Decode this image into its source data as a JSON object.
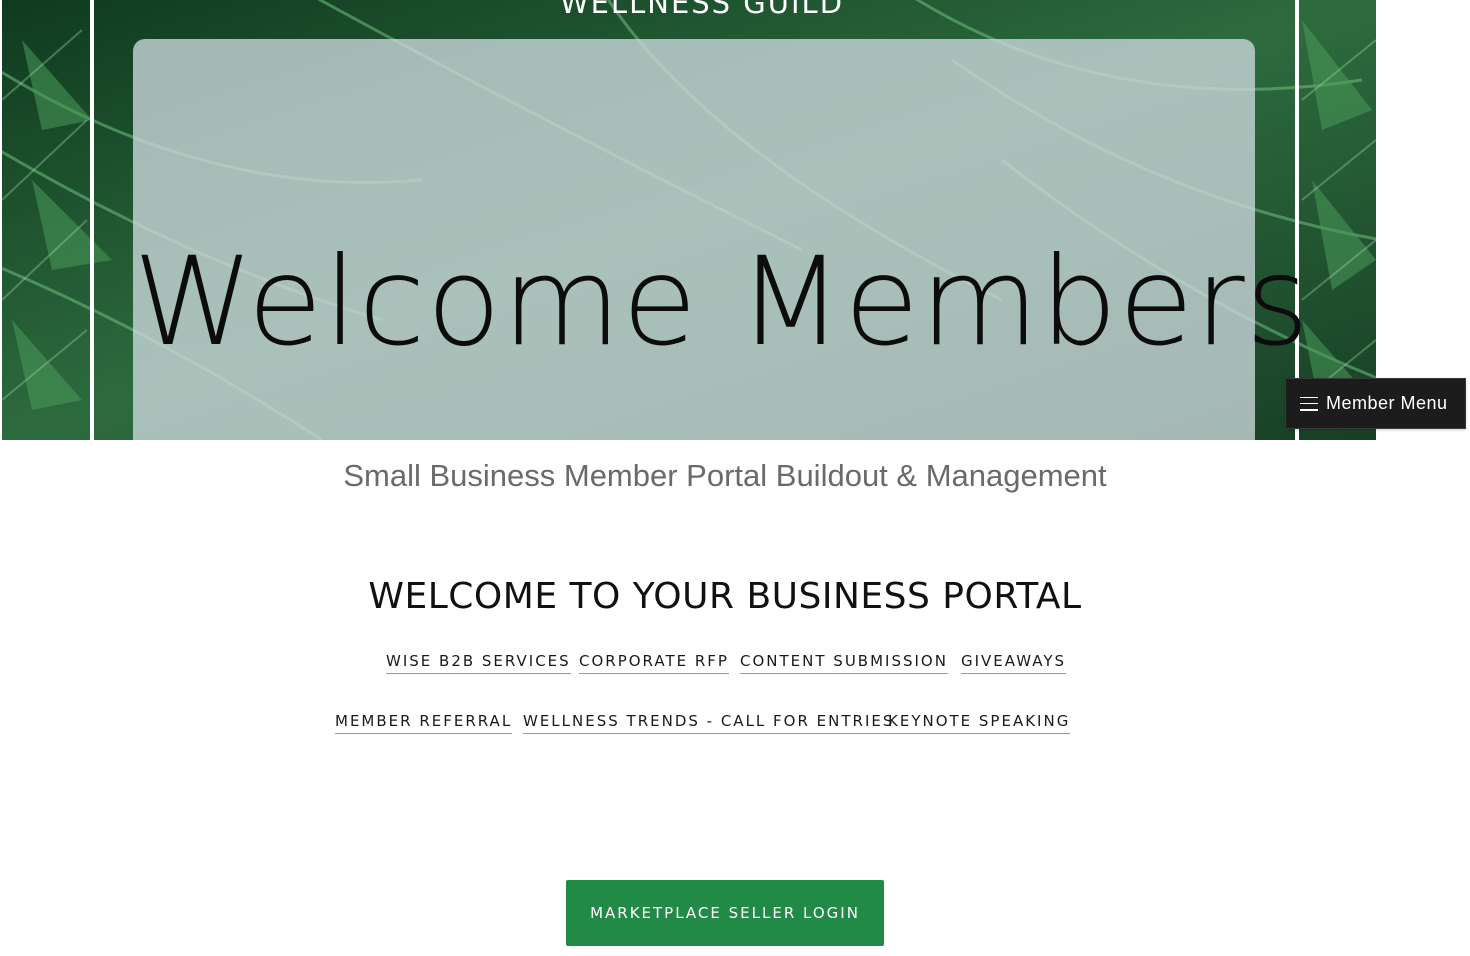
{
  "hero": {
    "org_name": "WELLNESS GUILD",
    "title": "Welcome Members"
  },
  "member_menu": {
    "label": "Member Menu",
    "icon": "hamburger-menu-icon"
  },
  "subtitle": "Small Business Member Portal Buildout & Management",
  "portal": {
    "heading": "WELCOME TO YOUR BUSINESS PORTAL",
    "links_row1": [
      "WISE B2B SERVICES",
      "CORPORATE RFP",
      "CONTENT SUBMISSION",
      "GIVEAWAYS"
    ],
    "links_row2": [
      "MEMBER REFERRAL",
      "WELLNESS TRENDS - CALL FOR ENTRIES",
      "KEYNOTE SPEAKING"
    ]
  },
  "seller_login": {
    "label": "MARKETPLACE SELLER LOGIN"
  },
  "colors": {
    "accent_green": "#218a47",
    "menu_bg": "#1c1c1c",
    "subtitle_gray": "#6a6a6a"
  }
}
